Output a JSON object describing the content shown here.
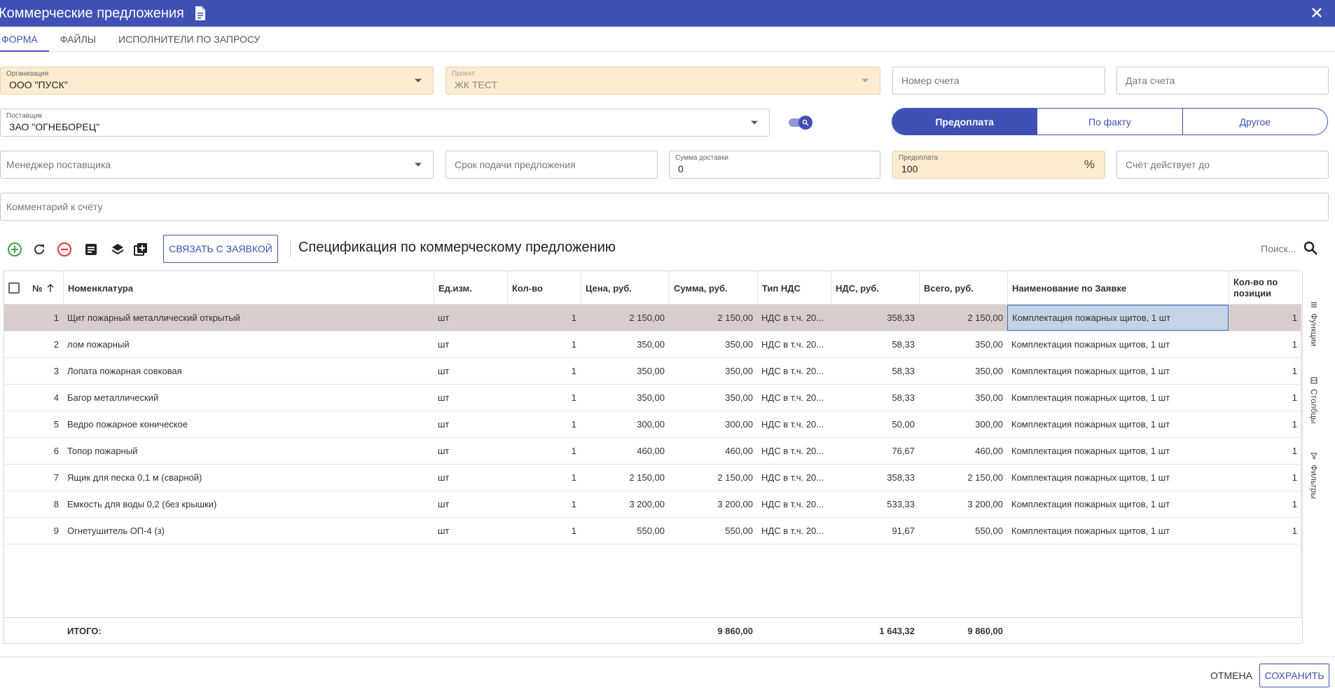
{
  "window": {
    "title": "Коммерческие предложения",
    "title_icon": "document-icon",
    "close_icon": "close-icon"
  },
  "tabs": [
    {
      "label": "ФОРМА",
      "active": true
    },
    {
      "label": "ФАЙЛЫ",
      "active": false
    },
    {
      "label": "ИСПОЛНИТЕЛИ ПО ЗАПРОСУ",
      "active": false
    }
  ],
  "form": {
    "organization": {
      "label": "Организация",
      "value": "ООО \"ПУСК\""
    },
    "project": {
      "label": "Проект",
      "value": "ЖК ТЕСТ"
    },
    "invoice_number": {
      "placeholder": "Номер счета"
    },
    "invoice_date": {
      "placeholder": "Дата счета"
    },
    "supplier": {
      "label": "Поставщик",
      "value": "ЗАО \"ОГНЕБОРЕЦ\""
    },
    "supplier_search_toggle": {
      "on": true,
      "icon": "search-icon"
    },
    "payment_options": [
      {
        "label": "Предоплата",
        "active": true
      },
      {
        "label": "По факту",
        "active": false
      },
      {
        "label": "Другое",
        "active": false
      }
    ],
    "supplier_manager": {
      "placeholder": "Менеджер поставщика"
    },
    "deadline": {
      "placeholder": "Срок подачи предложения"
    },
    "delivery_sum": {
      "label": "Сумма доставки",
      "value": "0"
    },
    "prepayment": {
      "label": "Предоплата",
      "value": "100",
      "suffix": "%"
    },
    "valid_until": {
      "placeholder": "Счёт действует до"
    },
    "comment": {
      "placeholder": "Комментарий к счёту"
    }
  },
  "toolbar": {
    "icons": [
      "add-icon",
      "refresh-icon",
      "remove-icon",
      "document-list-icon",
      "layers-icon",
      "copy-add-icon"
    ],
    "link_button": "СВЯЗАТЬ С ЗАЯВКОЙ",
    "spec_title": "Спецификация по коммерческому предложению",
    "search_placeholder": "Поиск..."
  },
  "table": {
    "columns": [
      "№",
      "Номенклатура",
      "Ед.изм.",
      "Кол-во",
      "Цена, руб.",
      "Сумма, руб.",
      "Тип НДС",
      "НДС, руб.",
      "Всего, руб.",
      "Наименование по Заявке",
      "Кол-во по позиции"
    ],
    "sort_column": "№",
    "rows": [
      {
        "n": "1",
        "name": "Щит пожарный металлический открытый",
        "unit": "шт",
        "qty": "1",
        "price": "2 150,00",
        "sum": "2 150,00",
        "vat_type": "НДС в т.ч. 20...",
        "vat": "358,33",
        "total": "2 150,00",
        "request_name": "Комплектация пожарных щитов, 1 шт",
        "pos_qty": "1"
      },
      {
        "n": "2",
        "name": "лом пожарный",
        "unit": "шт",
        "qty": "1",
        "price": "350,00",
        "sum": "350,00",
        "vat_type": "НДС в т.ч. 20...",
        "vat": "58,33",
        "total": "350,00",
        "request_name": "Комплектация пожарных щитов, 1 шт",
        "pos_qty": "1"
      },
      {
        "n": "3",
        "name": "Лопата пожарная совковая",
        "unit": "шт",
        "qty": "1",
        "price": "350,00",
        "sum": "350,00",
        "vat_type": "НДС в т.ч. 20...",
        "vat": "58,33",
        "total": "350,00",
        "request_name": "Комплектация пожарных щитов, 1 шт",
        "pos_qty": "1"
      },
      {
        "n": "4",
        "name": "Багор металлический",
        "unit": "шт",
        "qty": "1",
        "price": "350,00",
        "sum": "350,00",
        "vat_type": "НДС в т.ч. 20...",
        "vat": "58,33",
        "total": "350,00",
        "request_name": "Комплектация пожарных щитов, 1 шт",
        "pos_qty": "1"
      },
      {
        "n": "5",
        "name": "Ведро пожарное коническое",
        "unit": "шт",
        "qty": "1",
        "price": "300,00",
        "sum": "300,00",
        "vat_type": "НДС в т.ч. 20...",
        "vat": "50,00",
        "total": "300,00",
        "request_name": "Комплектация пожарных щитов, 1 шт",
        "pos_qty": "1"
      },
      {
        "n": "6",
        "name": "Топор пожарный",
        "unit": "шт",
        "qty": "1",
        "price": "460,00",
        "sum": "460,00",
        "vat_type": "НДС в т.ч. 20...",
        "vat": "76,67",
        "total": "460,00",
        "request_name": "Комплектация пожарных щитов, 1 шт",
        "pos_qty": "1"
      },
      {
        "n": "7",
        "name": "Ящик для песка 0,1 м (сварной)",
        "unit": "шт",
        "qty": "1",
        "price": "2 150,00",
        "sum": "2 150,00",
        "vat_type": "НДС в т.ч. 20...",
        "vat": "358,33",
        "total": "2 150,00",
        "request_name": "Комплектация пожарных щитов, 1 шт",
        "pos_qty": "1"
      },
      {
        "n": "8",
        "name": "Емкость для воды 0,2 (без крышки)",
        "unit": "шт",
        "qty": "1",
        "price": "3 200,00",
        "sum": "3 200,00",
        "vat_type": "НДС в т.ч. 20...",
        "vat": "533,33",
        "total": "3 200,00",
        "request_name": "Комплектация пожарных щитов, 1 шт",
        "pos_qty": "1"
      },
      {
        "n": "9",
        "name": "Огнетушитель ОП-4 (з)",
        "unit": "шт",
        "qty": "1",
        "price": "550,00",
        "sum": "550,00",
        "vat_type": "НДС в т.ч. 20...",
        "vat": "91,67",
        "total": "550,00",
        "request_name": "Комплектация пожарных щитов, 1 шт",
        "pos_qty": "1"
      }
    ],
    "footer": {
      "label": "ИТОГО:",
      "sum": "9 860,00",
      "vat": "1 643,32",
      "total": "9 860,00"
    },
    "side_tabs": [
      {
        "label": "Функции",
        "icon": "menu-icon"
      },
      {
        "label": "Столбцы",
        "icon": "columns-icon"
      },
      {
        "label": "Фильтры",
        "icon": "filter-icon"
      }
    ]
  },
  "actions": {
    "cancel": "ОТМЕНА",
    "save": "СОХРАНИТЬ"
  },
  "colors": {
    "primary": "#3f51b5",
    "highlight_field": "#fdecd0",
    "selected_row": "#d9cdcb",
    "add_icon": "#43a047",
    "remove_icon": "#e53935"
  }
}
